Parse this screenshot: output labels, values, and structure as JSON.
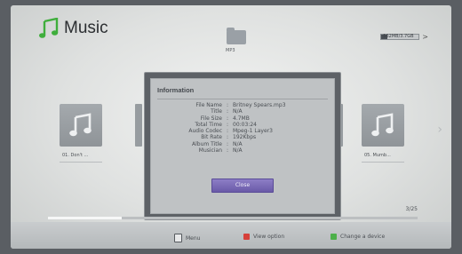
{
  "app": {
    "title": "Music"
  },
  "folder": {
    "label": "MP3"
  },
  "device": {
    "label": "562MB/3.7GB",
    "fill_fraction": 0.15
  },
  "thumbs": [
    {
      "caption": "01. Don't ..."
    },
    {
      "caption": "05. Mumb..."
    }
  ],
  "info": {
    "title": "Information",
    "rows": [
      {
        "k": "File Name",
        "v": "Britney Spears.mp3"
      },
      {
        "k": "Title",
        "v": "N/A"
      },
      {
        "k": "File Size",
        "v": "4.7MB"
      },
      {
        "k": "Total Time",
        "v": "00:03:24"
      },
      {
        "k": "Audio Codec",
        "v": "Mpeg-1 Layer3"
      },
      {
        "k": "Bit Rate",
        "v": "192Kbps"
      },
      {
        "k": "Album Title",
        "v": "N/A"
      },
      {
        "k": "Musician",
        "v": "N/A"
      }
    ],
    "close_label": "Close"
  },
  "playback": {
    "page": "3/25",
    "progress_fraction": 0.2
  },
  "hints": {
    "menu": "Menu",
    "view": "View option",
    "device": "Change a device",
    "colors": {
      "view": "#d6403a",
      "device": "#4db04a"
    }
  }
}
